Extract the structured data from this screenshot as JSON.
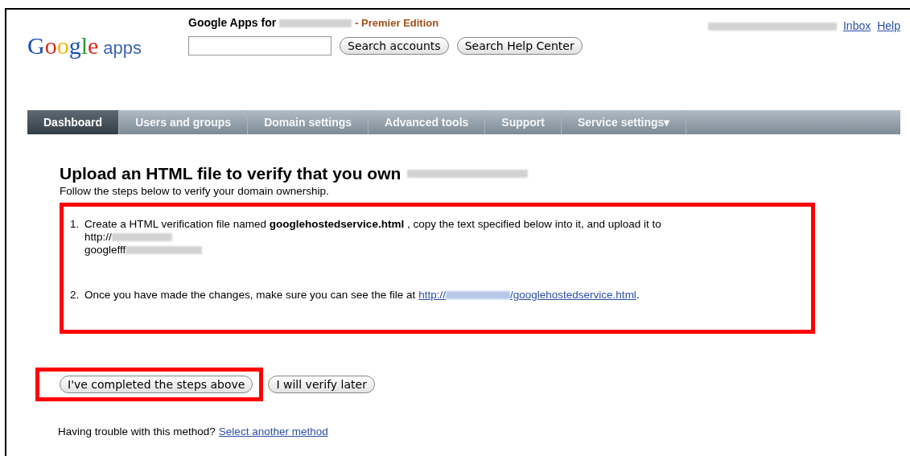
{
  "header": {
    "logo": {
      "word": "Google",
      "suffix": "apps"
    },
    "title": "Google Apps for",
    "edition": "- Premier Edition",
    "search_buttons": [
      "Search accounts",
      "Search Help Center"
    ],
    "links": [
      "Inbox",
      "Help"
    ]
  },
  "tabs": [
    {
      "label": "Dashboard",
      "selected": true
    },
    {
      "label": "Users and groups",
      "selected": false
    },
    {
      "label": "Domain settings",
      "selected": false
    },
    {
      "label": "Advanced tools",
      "selected": false
    },
    {
      "label": "Support",
      "selected": false
    },
    {
      "label": "Service settings▾",
      "selected": false
    }
  ],
  "heading": "Upload an HTML file to verify that you own",
  "subtitle": "Follow the steps below to verify your domain ownership.",
  "steps": [
    {
      "number": "1.",
      "text": "Create a HTML verification file named **googlehostedservice.html** , copy the text specified below into it, and upload it to",
      "lines": [
        "http://",
        "googlefff"
      ]
    },
    {
      "number": "2.",
      "text": "Once you have made the changes, make sure you can see the file at",
      "link_start": "http://",
      "link_end": "/googlehostedservice.html",
      "tail": "."
    }
  ],
  "buttons": [
    {
      "label": "I've completed the steps above",
      "highlighted": true
    },
    {
      "label": "I will verify later",
      "highlighted": false
    }
  ],
  "footer": {
    "text": "Having trouble with this method?",
    "link": "Select another method"
  }
}
